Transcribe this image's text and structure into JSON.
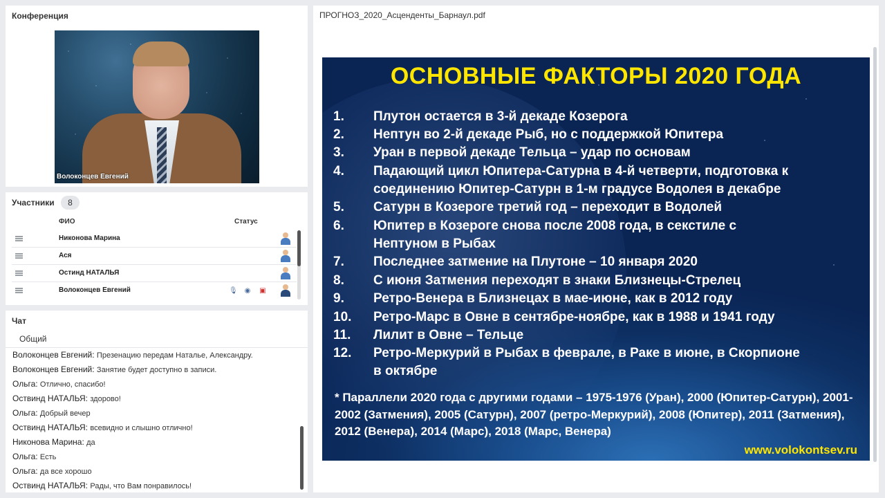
{
  "conference": {
    "title": "Конференция",
    "video_label": "Волоконцев  Евгений"
  },
  "participants": {
    "title": "Участники",
    "count": "8",
    "col_name": "ФИО",
    "col_status": "Статус",
    "rows": [
      {
        "name": "Никонова Марина"
      },
      {
        "name": "Ася"
      },
      {
        "name": "Остинд НАТАЛЬЯ"
      },
      {
        "name": "Волоконцев  Евгений"
      }
    ]
  },
  "chat": {
    "title": "Чат",
    "tab": "Общий",
    "messages": [
      {
        "author": "Волоконцев  Евгений:",
        "text": "Презенацию передам Наталье, Александру."
      },
      {
        "author": "Волоконцев  Евгений:",
        "text": "Занятие будет доступно в записи."
      },
      {
        "author": "Ольга:",
        "text": "Отлично, спасибо!"
      },
      {
        "author": "Оствинд НАТАЛЬЯ:",
        "text": "здорово!"
      },
      {
        "author": "Ольга:",
        "text": "Добрый вечер"
      },
      {
        "author": "Оствинд НАТАЛЬЯ:",
        "text": "всевидно и слышно отлично!"
      },
      {
        "author": "Никонова Марина:",
        "text": "да"
      },
      {
        "author": "Ольга:",
        "text": "Есть"
      },
      {
        "author": "Ольга:",
        "text": "да все хорошо"
      },
      {
        "author": "Оствинд НАТАЛЬЯ:",
        "text": "Рады, что Вам понравилось!"
      }
    ]
  },
  "document": {
    "filename": "ПРОГНОЗ_2020_Асценденты_Барнаул.pdf",
    "slide": {
      "title": "ОСНОВНЫЕ ФАКТОРЫ 2020 ГОДА",
      "items": [
        {
          "num": "1.",
          "line1": "Плутон остается в 3-й декаде Козерога",
          "line2": ""
        },
        {
          "num": "2.",
          "line1": "Нептун во 2-й декаде Рыб, но с поддержкой Юпитера",
          "line2": ""
        },
        {
          "num": "3.",
          "line1": "Уран в первой декаде Тельца – удар по основам",
          "line2": ""
        },
        {
          "num": "4.",
          "line1": "Падающий цикл Юпитера-Сатурна в 4-й четверти, подготовка к",
          "line2": "соединению Юпитер-Сатурн в 1-м градусе Водолея в декабре"
        },
        {
          "num": "5.",
          "line1": "Сатурн в Козероге третий год – переходит в Водолей",
          "line2": ""
        },
        {
          "num": "6.",
          "line1": "Юпитер в Козероге снова после 2008 года, в секстиле с",
          "line2": "Нептуном в Рыбах"
        },
        {
          "num": "7.",
          "line1": "Последнее затмение на Плутоне – 10 января 2020",
          "line2": ""
        },
        {
          "num": "8.",
          "line1": "С июня Затмения переходят в знаки Близнецы-Стрелец",
          "line2": ""
        },
        {
          "num": "9.",
          "line1": "Ретро-Венера в Близнецах в мае-июне, как в 2012 году",
          "line2": ""
        },
        {
          "num": "10.",
          "line1": "Ретро-Марс в Овне в сентябре-ноябре, как в 1988 и 1941 году",
          "line2": ""
        },
        {
          "num": "11.",
          "line1": "Лилит в Овне – Тельце",
          "line2": ""
        },
        {
          "num": "12.",
          "line1": "Ретро-Меркурий в Рыбах в феврале, в Раке в июне, в Скорпионе",
          "line2": "в октябре"
        }
      ],
      "note": "* Параллели 2020 года с другими годами – 1975-1976 (Уран), 2000 (Юпитер-Сатурн), 2001-2002 (Затмения), 2005 (Сатурн), 2007 (ретро-Меркурий), 2008 (Юпитер), 2011 (Затмения), 2012 (Венера), 2014 (Марс), 2018 (Марс, Венера)",
      "url": "www.volokontsev.ru"
    }
  }
}
